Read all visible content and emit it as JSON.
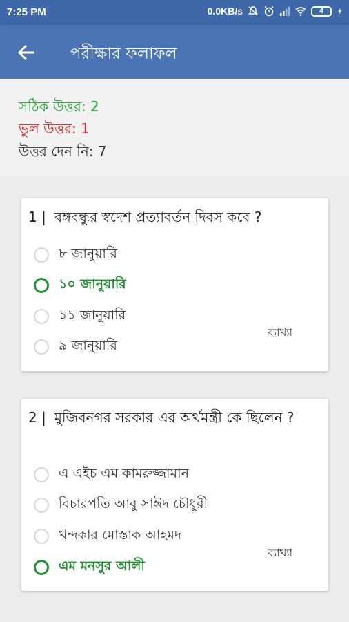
{
  "status": {
    "time": "7:25 PM",
    "speed": "0.0KB/s",
    "battery": "4"
  },
  "appbar": {
    "title": "পরীক্ষার ফলাফল"
  },
  "summary": {
    "correct": "সঠিক উত্তর: 2",
    "wrong": "ভুল উত্তর: 1",
    "unanswered": "উত্তর দেন নি: 7"
  },
  "colors": {
    "appbar": "#4b74b5",
    "statusbar": "#3f68a8",
    "correct": "#1fa62c",
    "wrong": "#d7262a"
  },
  "questions": [
    {
      "number": "1 |",
      "text": "বঙ্গবন্ধুর স্বদেশ প্রত্যাবর্তন দিবস কবে ?",
      "options": [
        "৮ জানুয়ারি",
        "১০ জানুয়ারি",
        "১১ জানুয়ারি",
        "৯ জানুয়ারি"
      ],
      "correct_index": 1,
      "explain": "ব্যাখ্যা"
    },
    {
      "number": "2 |",
      "text": "মুজিবনগর সরকার এর অর্থমন্ত্রী কে ছিলেন ?",
      "options": [
        "এ এইচ এম কামরুজ্জামান",
        "বিচারপতি আবু সাঈদ চৌধুরী",
        "খন্দকার মোস্তাক আহমদ",
        "এম মনসুর আলী"
      ],
      "correct_index": 3,
      "explain": "ব্যাখ্যা"
    }
  ]
}
